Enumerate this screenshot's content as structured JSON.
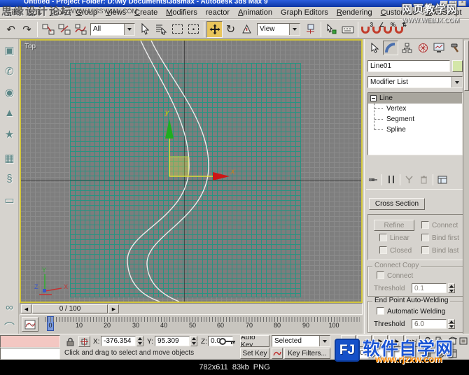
{
  "window": {
    "title": "Untitled - Project Folder: D:\\My Documents\\3dsmax - Autodesk 3ds Max 9"
  },
  "menu": {
    "items": [
      "File",
      "Edit",
      "Tools",
      "Group",
      "Views",
      "Create",
      "Modifiers",
      "reactor",
      "Animation",
      "Graph Editors",
      "Rendering",
      "Customize",
      "MAXScript"
    ]
  },
  "toolbar": {
    "selection_filter_value": "All",
    "coordinate_system_value": "View"
  },
  "icons": {
    "undo": "↶",
    "redo": "↷",
    "rotate": "↻",
    "snap3_sup": "3",
    "angle_sup": "∠",
    "percent_sup": "%",
    "spinner_sup": "⇅",
    "region_dot": "•",
    "goto_start": "|◀◀",
    "prev_frame": "◀|",
    "play": "▶",
    "next_frame": "|▶",
    "goto_end": "▶▶|",
    "key_mode": "◀▶",
    "slider_prev": "◀",
    "slider_next": "▶",
    "window_minimize": "_",
    "window_maximize": "□",
    "window_close": "×"
  },
  "left_shelf": {
    "icons": [
      {
        "name": "boxes",
        "glyph": "▣"
      },
      {
        "name": "phone",
        "glyph": "✆"
      },
      {
        "name": "sphere",
        "glyph": "◉"
      },
      {
        "name": "cone",
        "glyph": "▲"
      },
      {
        "name": "star",
        "glyph": "★"
      },
      {
        "name": "blocks",
        "glyph": "▦"
      },
      {
        "name": "spring",
        "glyph": "§"
      },
      {
        "name": "capsule",
        "glyph": "▭"
      },
      {
        "name": "knot",
        "glyph": "∞"
      },
      {
        "name": "arc",
        "glyph": "⌒"
      }
    ]
  },
  "viewport": {
    "label": "Top",
    "gizmo": {
      "x_label": "x",
      "y_label": "y"
    },
    "tripod": {
      "x_label": "X",
      "y_label": "Y",
      "z_label": "Z"
    }
  },
  "command_panel": {
    "object_name": "Line01",
    "modifier_list_label": "Modifier List",
    "stack": {
      "root": "Line",
      "children": [
        "Vertex",
        "Segment",
        "Spline"
      ]
    },
    "cross_section_button": "Cross Section",
    "rollout": {
      "refine": "Refine",
      "connect": "Connect",
      "linear": "Linear",
      "bind_first": "Bind first",
      "closed": "Closed",
      "bind_last": "Bind last"
    },
    "connect_copy": {
      "title": "Connect Copy",
      "connect": "Connect",
      "threshold_label": "Threshold",
      "threshold_value": "0.1"
    },
    "end_point_welding": {
      "title": "End Point Auto-Welding",
      "automatic_welding": "Automatic Welding",
      "threshold_label": "Threshold",
      "threshold_value": "6.0"
    }
  },
  "timeline": {
    "slider_value": "0 / 100",
    "ticks": [
      "0",
      "10",
      "20",
      "30",
      "40",
      "50",
      "60",
      "70",
      "80",
      "90",
      "100"
    ]
  },
  "status_bar": {
    "x_label": "X:",
    "x_value": "-376.354",
    "y_label": "Y:",
    "y_value": "95.309",
    "z_label": "Z:",
    "z_value": "0.0",
    "auto_key": "Auto Key",
    "set_key": "Set Key",
    "key_filter_value": "Selected",
    "key_filters": "Key Filters...",
    "frame_value": "0",
    "prompt": "Click and drag to select and move objects"
  },
  "footer": {
    "info": "782x611  83kb  PNG"
  },
  "watermarks": {
    "missyuan": {
      "title": "思缘设计论坛",
      "url": "WWW.MISSYUAN.COM"
    },
    "webjx": {
      "title": "网页教学网",
      "url": "WWW.WEBJX.COM"
    },
    "rjzxw": {
      "title": "软件自学网",
      "url": "www.rjzxw.com",
      "logo": "FJ"
    }
  },
  "colors": {
    "active_tool_highlight": "#e9c55b",
    "viewport_border": "#d2c53c",
    "grid_teal": "#239682",
    "title_blue": "#1b4fd0",
    "magnet_red": "#c23b2a"
  }
}
